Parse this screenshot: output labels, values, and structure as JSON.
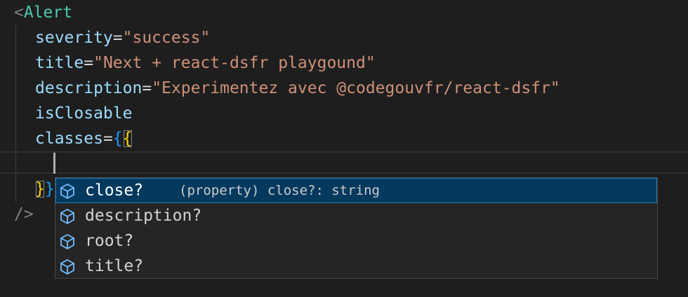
{
  "code": {
    "line1": {
      "open": "<",
      "tag": "Alert"
    },
    "line2": {
      "attr": "severity",
      "eq": "=",
      "value": "\"success\""
    },
    "line3": {
      "attr": "title",
      "eq": "=",
      "value": "\"Next + react-dsfr playgound\""
    },
    "line4": {
      "attr": "description",
      "eq": "=",
      "value": "\"Experimentez avec @codegouvfr/react-dsfr\""
    },
    "line5": {
      "attr": "isClosable"
    },
    "line6": {
      "attr": "classes",
      "eq": "=",
      "brace_outer": "{",
      "brace_inner": "{"
    },
    "line8": {
      "brace_inner": "}",
      "brace_outer": "}"
    },
    "line9": {
      "close": "/>"
    }
  },
  "suggest": {
    "items": [
      {
        "label": "close?",
        "detail": "(property) close?: string",
        "icon": "cube-icon",
        "selected": true
      },
      {
        "label": "description?",
        "detail": "",
        "icon": "cube-icon",
        "selected": false
      },
      {
        "label": "root?",
        "detail": "",
        "icon": "cube-icon",
        "selected": false
      },
      {
        "label": "title?",
        "detail": "",
        "icon": "cube-icon",
        "selected": false
      }
    ]
  },
  "colors": {
    "background": "#1e1e1e",
    "suggest_bg": "#252526",
    "selection": "#04395e",
    "icon": "#75beff"
  }
}
